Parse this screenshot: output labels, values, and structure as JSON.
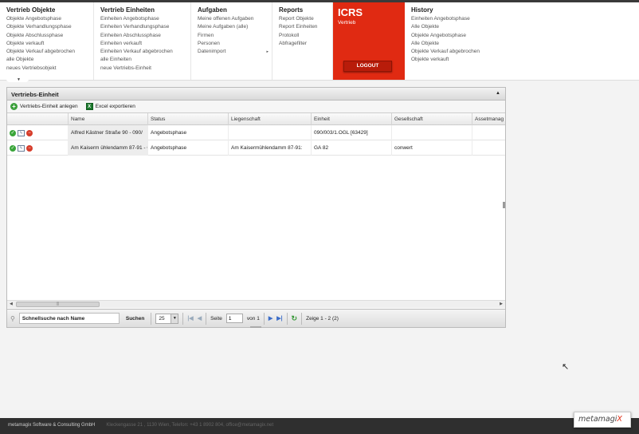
{
  "nav": {
    "columns": [
      {
        "title": "Vertrieb Objekte",
        "items": [
          "Objekte Angebotsphase",
          "Objekte Verhandlungsphase",
          "Objekte Abschlussphase",
          "Objekte verkauft",
          "Objekte Verkauf abgebrochen",
          "alle Objekte",
          "neues Vertriebsobjekt"
        ]
      },
      {
        "title": "Vertrieb Einheiten",
        "items": [
          "Einheiten Angebotsphase",
          "Einheiten Verhandlungsphase",
          "Einheiten Abschlussphase",
          "Einheiten verkauft",
          "Einheiten Verkauf abgebrochen",
          "alle Einheiten",
          "neue Vertriebs-Einheit"
        ]
      },
      {
        "title": "Aufgaben",
        "items": [
          "Meine offenen Aufgaben",
          "Meine Aufgaben (alle)",
          "Firmen",
          "Personen",
          "Datenimport"
        ]
      },
      {
        "title": "Reports",
        "items": [
          "Report Objekte",
          "Report Einheiten",
          "Protokoll",
          "Abfragefilter"
        ]
      }
    ],
    "icrs": {
      "title": "ICRS",
      "subtitle": "Vertrieb",
      "logout": "LOGOUT"
    },
    "history": {
      "title": "History",
      "items": [
        "Einheiten Angebotsphase",
        "Alle Objekte",
        "Objekte Angebotsphase",
        "Alle Objekte",
        "Objekte Verkauf abgebrochen",
        "Objekte verkauft"
      ]
    }
  },
  "panel": {
    "title": "Vertriebs-Einheit",
    "toolbar": {
      "add": "Vertriebs-Einheit anlegen",
      "export": "Excel exportieren"
    },
    "columns": [
      "Name",
      "Status",
      "Liegenschaft",
      "Einheit",
      "Gesellschaft",
      "Assetmanag"
    ],
    "rows": [
      [
        "Alfred Kästner Straße 90 - 090/",
        "Angebotsphase",
        "",
        "090/003/1.OGL [63429]",
        "",
        ""
      ],
      [
        "Am Kaiserm ühlendamm 87-91 - C",
        "Angebotsphase",
        "Am Kaisermühlendamm 87-91:",
        "GA 82",
        "conwert",
        ""
      ]
    ],
    "pager": {
      "search_placeholder": "Schnellsuche nach Name",
      "search_button": "Suchen",
      "page_size": "25",
      "page_label": "Seite",
      "page_value": "1",
      "of_label": "von 1",
      "summary": "Zeige 1 - 2 (2)"
    }
  },
  "footer": {
    "company": "metamagix Software & Consulting GmbH",
    "address": "Kleckengasse 21 , 1130 Wien, Telefon: +43 1 8902 804, office@metamagix.net"
  },
  "logo": {
    "text": "metamagi",
    "x": "X"
  }
}
